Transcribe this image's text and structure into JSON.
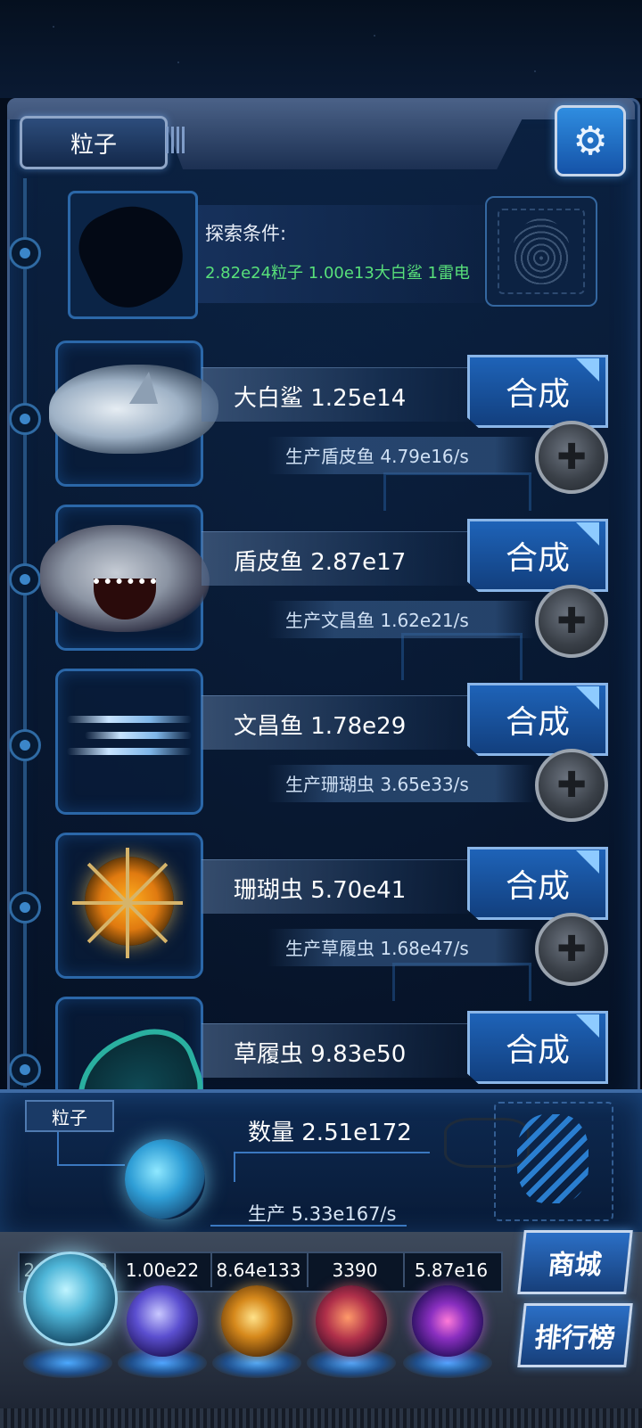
{
  "header": {
    "tab_label": "粒子",
    "settings_icon": "gear-icon"
  },
  "explore": {
    "label": "探索条件:",
    "condition": "2.82e24粒子 1.00e13大白鲨 1雷电",
    "scan_icon": "fingerprint-icon",
    "locked_icon": "salamander-silhouette-icon"
  },
  "rows": [
    {
      "name": "大白鲨 1.25e14",
      "merge": "合成",
      "production": "生产盾皮鱼 4.79e16/s",
      "icon": "shark-icon"
    },
    {
      "name": "盾皮鱼 2.87e17",
      "merge": "合成",
      "production": "生产文昌鱼 1.62e21/s",
      "icon": "dunkleosteus-icon"
    },
    {
      "name": "文昌鱼 1.78e29",
      "merge": "合成",
      "production": "生产珊瑚虫 3.65e33/s",
      "icon": "lancelet-icon"
    },
    {
      "name": "珊瑚虫 5.70e41",
      "merge": "合成",
      "production": "生产草履虫 1.68e47/s",
      "icon": "coral-polyp-icon"
    },
    {
      "name": "草履虫 9.83e50",
      "merge": "合成",
      "production": "",
      "icon": "paramecium-icon"
    }
  ],
  "info": {
    "label": "粒子",
    "count": "数量 2.51e172",
    "production": "生产 5.33e167/s"
  },
  "resources": [
    {
      "value": "2.51e172",
      "icon": "particle-orb-icon"
    },
    {
      "value": "1.00e22",
      "icon": "lightning-orb-icon"
    },
    {
      "value": "8.64e133",
      "icon": "fire-orb-icon"
    },
    {
      "value": "3390",
      "icon": "brain-orb-icon"
    },
    {
      "value": "5.87e16",
      "icon": "vortex-orb-icon"
    }
  ],
  "side_buttons": {
    "shop": "商城",
    "ranking": "排行榜"
  },
  "colors": {
    "accent_blue": "#1e63b8",
    "condition_green": "#58e07a",
    "frame": "#3d5a86"
  }
}
